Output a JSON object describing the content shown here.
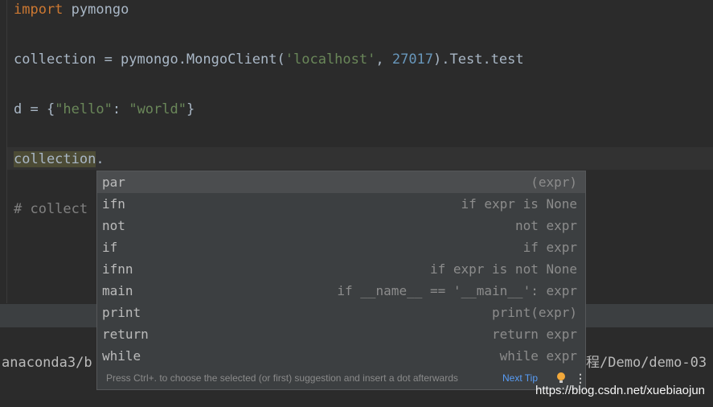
{
  "editor": {
    "line1": {
      "kw": "import",
      "rest": " pymongo"
    },
    "line2": {
      "pre": "collection = pymongo.MongoClient(",
      "str": "'localhost'",
      "mid": ", ",
      "num": "27017",
      "post": ").Test.test"
    },
    "line3": {
      "pre": "d = {",
      "str1": "\"hello\"",
      "mid": ": ",
      "str2": "\"world\"",
      "post": "}"
    },
    "line4": {
      "word": "collection",
      "dot": "."
    },
    "line5": {
      "comment": "# collect"
    }
  },
  "terminal": {
    "left": "anaconda3/b",
    "right": "程/Demo/demo-03"
  },
  "completion": {
    "items": [
      {
        "name": "par",
        "desc": "(expr)"
      },
      {
        "name": "ifn",
        "desc": "if expr is None"
      },
      {
        "name": "not",
        "desc": "not expr"
      },
      {
        "name": "if",
        "desc": "if expr"
      },
      {
        "name": "ifnn",
        "desc": "if expr is not None"
      },
      {
        "name": "main",
        "desc": "if __name__ == '__main__': expr"
      },
      {
        "name": "print",
        "desc": "print(expr)"
      },
      {
        "name": "return",
        "desc": "return expr"
      },
      {
        "name": "while",
        "desc": "while expr"
      }
    ],
    "hint": "Press Ctrl+. to choose the selected (or first) suggestion and insert a dot afterwards",
    "next_tip": "Next Tip",
    "bulb_icon": "lightbulb-icon",
    "more_icon": "more-vertical-icon"
  },
  "watermark": "https://blog.csdn.net/xuebiaojun",
  "colors": {
    "keyword": "#cc7832",
    "string": "#6a8759",
    "number": "#6897bb",
    "comment": "#808080",
    "link": "#589df6"
  }
}
